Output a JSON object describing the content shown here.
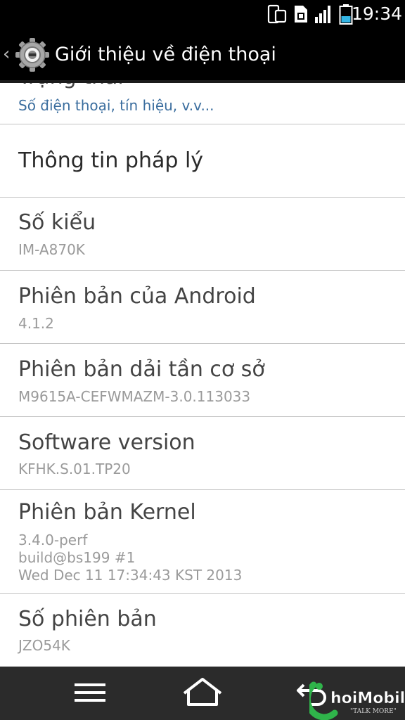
{
  "status_bar": {
    "time": "19:34",
    "icons": [
      "screen-mirror-icon",
      "sim-card-icon",
      "signal-icon",
      "battery-icon"
    ]
  },
  "action_bar": {
    "title": "Giới thiệu về điện thoại",
    "icon": "settings-gear-icon"
  },
  "items": [
    {
      "title": "Trạng thái",
      "summary": "Số điện thoại, tín hiệu, v.v..."
    },
    {
      "title": "Thông tin pháp lý",
      "summary": ""
    },
    {
      "title": "Số kiểu",
      "summary": "IM-A870K"
    },
    {
      "title": "Phiên bản của Android",
      "summary": "4.1.2"
    },
    {
      "title": "Phiên bản dải tần cơ sở",
      "summary": "M9615A-CEFWMAZM-3.0.113033"
    },
    {
      "title": "Software version",
      "summary": "KFHK.S.01.TP20"
    },
    {
      "title": "Phiên bản Kernel",
      "summary": "3.4.0-perf\nbuild@bs199 #1\nWed Dec 11 17:34:43 KST 2013"
    },
    {
      "title": "Số phiên bản",
      "summary": "JZO54K"
    }
  ],
  "nav_bar": {
    "buttons": [
      "menu-icon",
      "home-icon",
      "back-icon"
    ]
  },
  "watermark": {
    "brand": "ChoiMobile",
    "tagline": "\"TALK MORE\""
  },
  "colors": {
    "status_bar_bg": "#000000",
    "action_bar_bg": "#000000",
    "list_bg": "#ffffff",
    "title_text": "#444444",
    "summary_text": "#9a9a9a",
    "summary_link": "#3a6d9e",
    "divider": "#c4c4c4",
    "nav_bar_bg": "#2b2b2b",
    "battery_fill": "#33b5e5"
  }
}
